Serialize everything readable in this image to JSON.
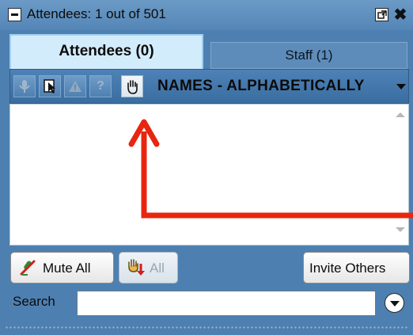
{
  "window": {
    "title": "Attendees:  1 out of 501",
    "collapse_icon": "minus-icon",
    "popout_icon": "popout-icon",
    "close_label": "✖"
  },
  "tabs": [
    {
      "label": "Attendees (0)",
      "active": true
    },
    {
      "label": "Staff (1)",
      "active": false
    }
  ],
  "toolbar": {
    "icons": [
      "microphone-icon",
      "pointer-icon",
      "alert-icon",
      "question-icon",
      "raise-hand-icon"
    ],
    "question_glyph": "?",
    "alert_glyph": "!",
    "sort_label": "NAMES - ALPHABETICALLY",
    "sort_dropdown_icon": "chevron-down-icon"
  },
  "list": {
    "items": []
  },
  "actions": {
    "mute_all": "Mute All",
    "lower_hands": "All",
    "invite_others": "Invite Others"
  },
  "search": {
    "label": "Search",
    "value": "",
    "placeholder": "",
    "options_icon": "chevron-down-circle-icon"
  },
  "colors": {
    "panel_bg": "#4d80b0",
    "active_tab": "#d3ecfb",
    "annotation_arrow": "#e8260f"
  }
}
